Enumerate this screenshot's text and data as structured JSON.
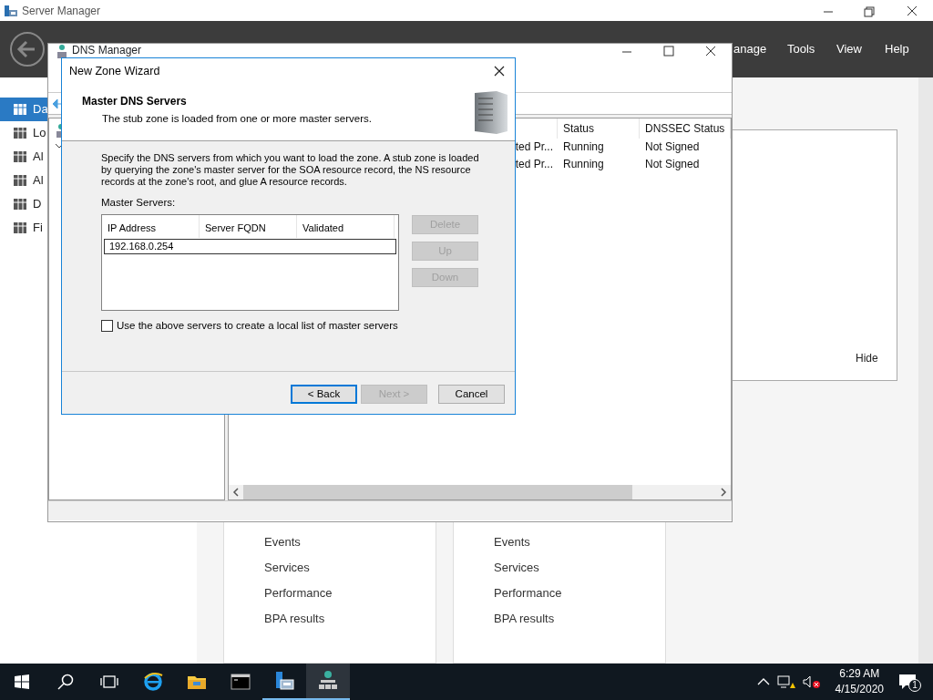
{
  "server_manager": {
    "title": "Server Manager",
    "menu": [
      "anage",
      "Tools",
      "View",
      "Help"
    ],
    "sidebar": [
      {
        "label": "Da",
        "selected": true
      },
      {
        "label": "Lo",
        "selected": false
      },
      {
        "label": "Al",
        "selected": false
      },
      {
        "label": "Al",
        "selected": false
      },
      {
        "label": "D",
        "selected": false
      },
      {
        "label": "Fi",
        "selected": false
      }
    ],
    "hide": "Hide",
    "tiles": [
      {
        "items": [
          "Events",
          "Services",
          "Performance",
          "BPA results"
        ]
      },
      {
        "items": [
          "Events",
          "Services",
          "Performance",
          "BPA results"
        ]
      }
    ]
  },
  "dns_manager": {
    "title": "DNS Manager",
    "columns": [
      "",
      "Status",
      "DNSSEC Status"
    ],
    "rows": [
      {
        "cells": [
          "ted Pr...",
          "Running",
          "Not Signed"
        ]
      },
      {
        "cells": [
          "ted Pr...",
          "Running",
          "Not Signed"
        ]
      }
    ]
  },
  "wizard": {
    "title": "New Zone Wizard",
    "heading": "Master DNS Servers",
    "subheading": "The stub zone is loaded from one or more master servers.",
    "description": "Specify the DNS servers from which you want to load the zone. A stub zone is loaded by querying the zone's master server for the SOA resource record, the NS resource records at the zone's root, and glue A resource records.",
    "list_label": "Master Servers:",
    "list_columns": [
      "IP Address",
      "Server FQDN",
      "Validated"
    ],
    "servers": [
      {
        "ip": "192.168.0.254"
      }
    ],
    "side_buttons": [
      {
        "label": "Delete",
        "disabled": true
      },
      {
        "label": "Up",
        "disabled": true
      },
      {
        "label": "Down",
        "disabled": true
      }
    ],
    "checkbox": {
      "label": "Use the above servers to create a local list of master servers",
      "checked": false
    },
    "buttons": [
      {
        "label": "< Back",
        "disabled": false,
        "default": true
      },
      {
        "label": "Next >",
        "disabled": true,
        "default": false
      },
      {
        "label": "Cancel",
        "disabled": false,
        "default": false
      }
    ]
  },
  "taskbar": {
    "apps": [
      {
        "kind": "ie",
        "active": false
      },
      {
        "kind": "explorer",
        "active": false
      },
      {
        "kind": "cmd",
        "active": false
      },
      {
        "kind": "servermanager",
        "active": true
      },
      {
        "kind": "dns",
        "active": true
      }
    ],
    "time": "6:29 AM",
    "date": "4/15/2020",
    "notifications": "1"
  }
}
